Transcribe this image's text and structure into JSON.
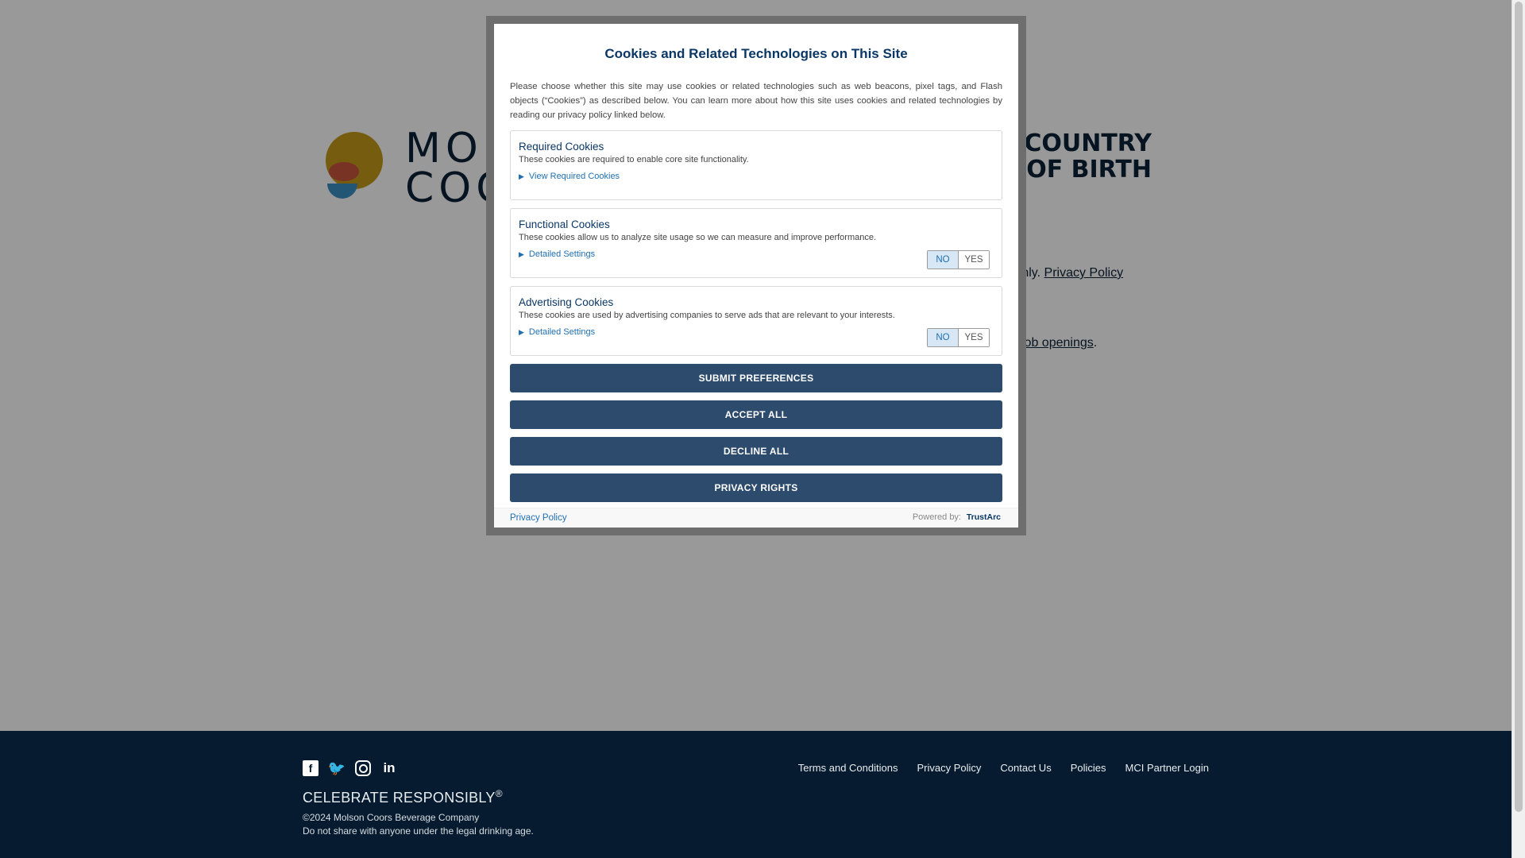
{
  "background": {
    "logo_text_line1": "MOLSON",
    "logo_text_line2": "COORS",
    "heading_line1": "R COUNTRY",
    "heading_line2": "TE OF BIRTH",
    "privacy_prefix": "s only.",
    "privacy_link": "Privacy Policy",
    "jobs_link": "job openings",
    "jobs_suffix": "."
  },
  "modal": {
    "title": "Cookies and Related Technologies on This Site",
    "intro": "Please choose whether this site may use cookies or related technologies such as web beacons, pixel tags, and Flash objects (“Cookies”) as described below. You can learn more about how this site uses cookies and related technologies by reading our privacy policy linked below.",
    "categories": [
      {
        "title": "Required Cookies",
        "description": "These cookies are required to enable core site functionality.",
        "link": "View Required Cookies"
      },
      {
        "title": "Functional Cookies",
        "description": "These cookies allow us to analyze site usage so we can measure and improve performance.",
        "link": "Detailed Settings",
        "no_label": "NO",
        "yes_label": "YES",
        "selected": "NO"
      },
      {
        "title": "Advertising Cookies",
        "description": "These cookies are used by advertising companies to serve ads that are relevant to your interests.",
        "link": "Detailed Settings",
        "no_label": "NO",
        "yes_label": "YES",
        "selected": "NO"
      }
    ],
    "buttons": {
      "submit": "SUBMIT PREFERENCES",
      "accept": "ACCEPT ALL",
      "decline": "DECLINE ALL",
      "privacy_rights": "PRIVACY RIGHTS"
    },
    "footer": {
      "privacy_policy": "Privacy Policy",
      "powered_by": "Powered by:",
      "brand": "TrustArc"
    }
  },
  "footer": {
    "social": [
      "facebook-icon",
      "twitter-icon",
      "instagram-icon",
      "linkedin-icon"
    ],
    "links": [
      "Terms and Conditions",
      "Privacy Policy",
      "Contact Us",
      "Policies",
      "MCI Partner Login"
    ],
    "celebrate": "CELEBRATE RESPONSIBLY",
    "celebrate_mark": "®",
    "copyright": "©2024 Molson Coors Beverage Company",
    "disclaimer": "Do not share with anyone under the legal drinking age."
  },
  "colors": {
    "modal_title": "#0a3766",
    "button_bg": "#2d4b6c",
    "footer_bg": "#061b2f",
    "link": "#1f6fb2"
  }
}
